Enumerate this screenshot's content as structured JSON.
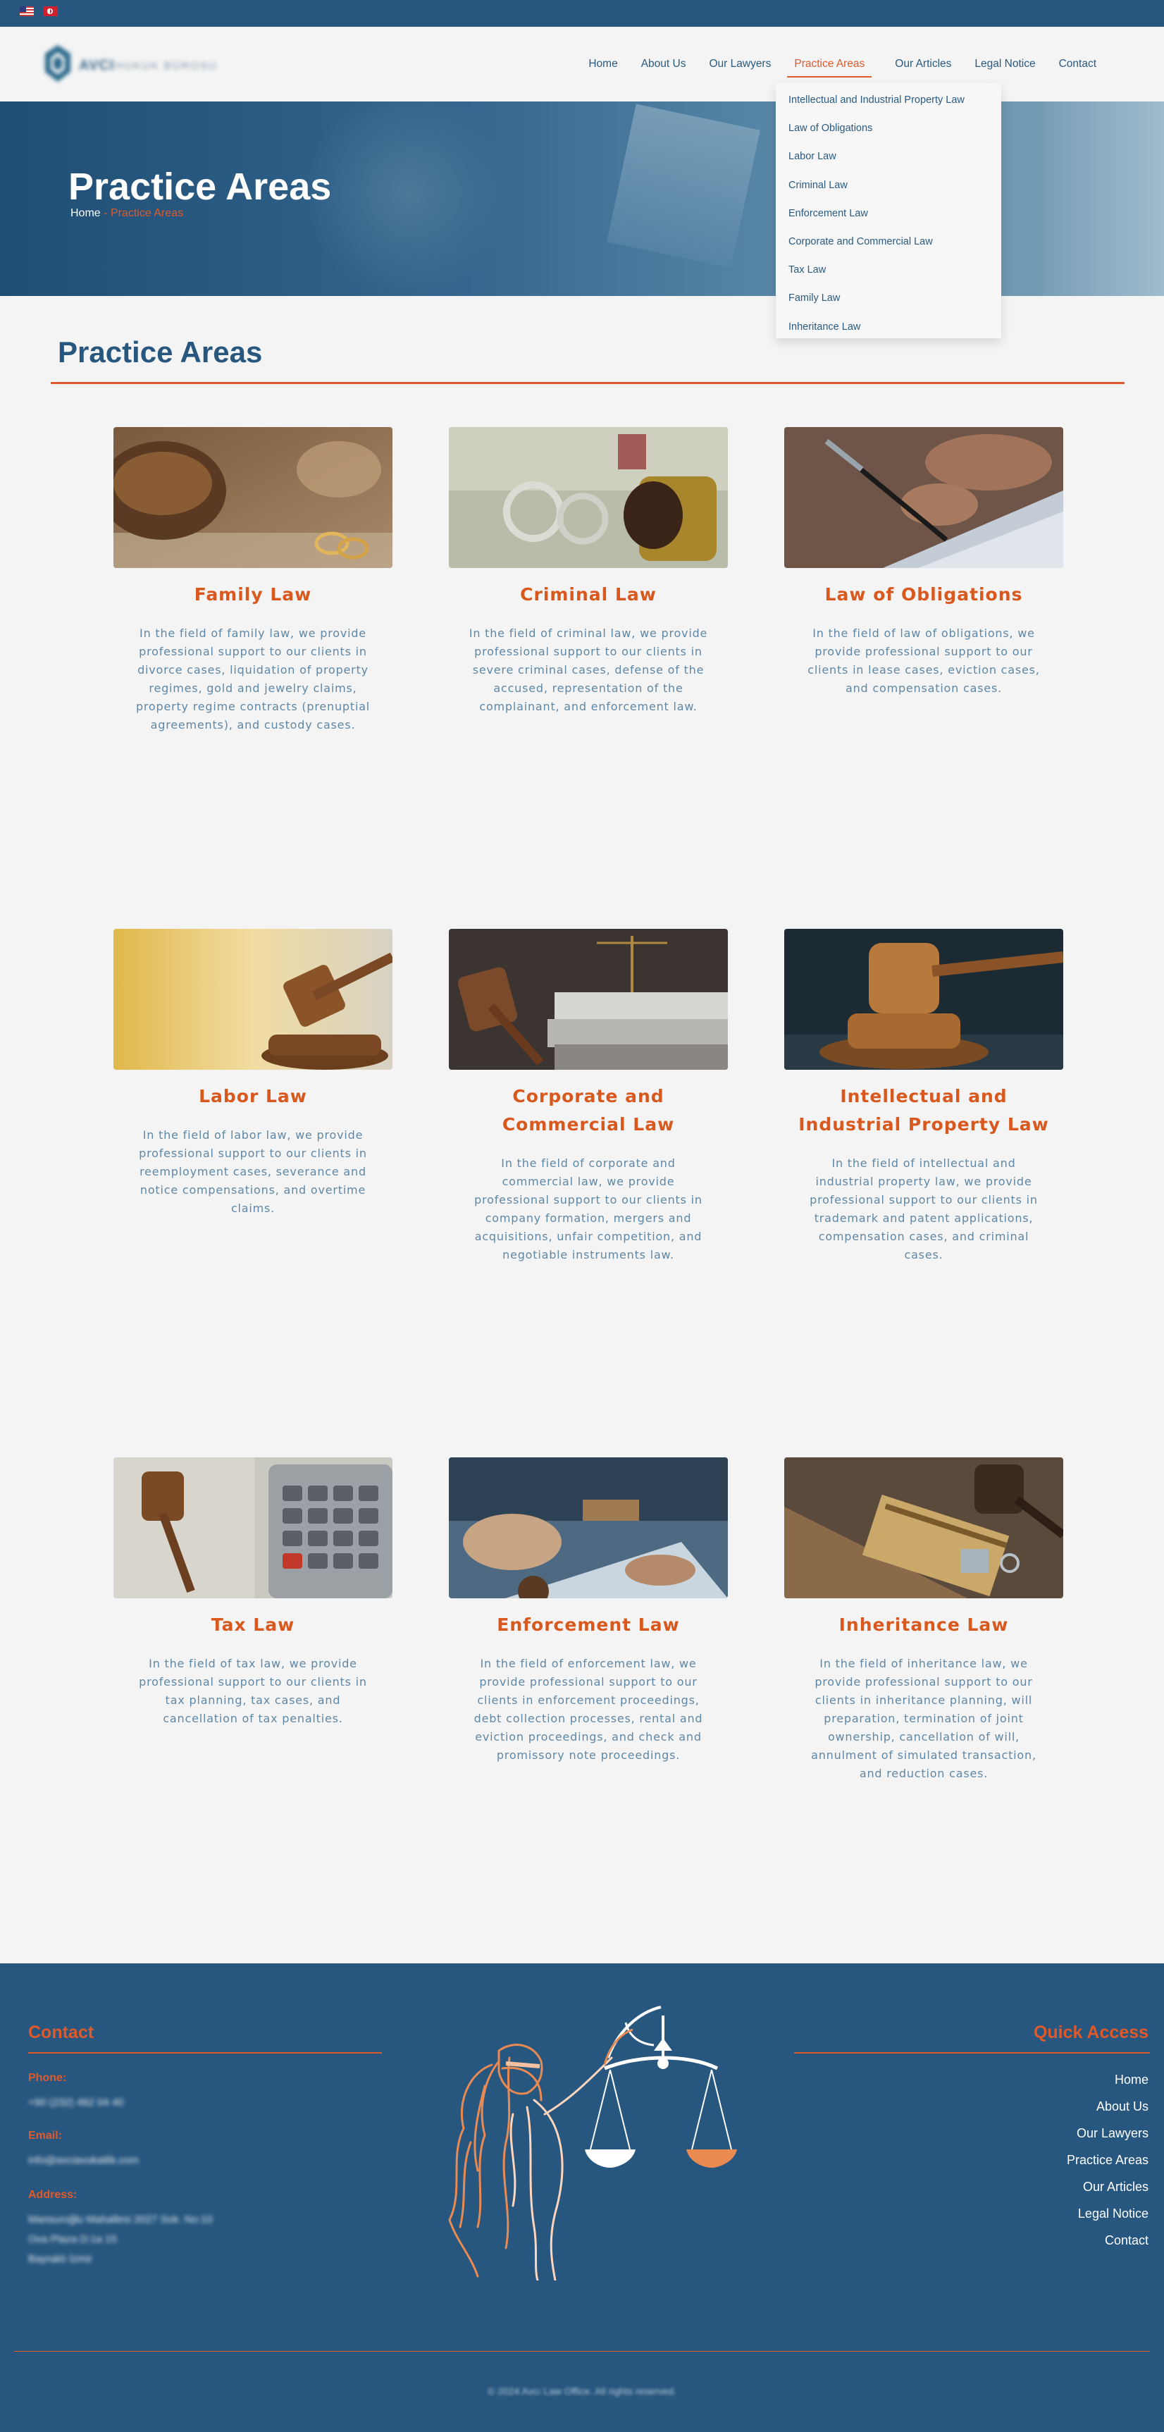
{
  "languages": [
    {
      "icon": "us-flag-icon"
    },
    {
      "icon": "tr-flag-icon"
    }
  ],
  "logo": {
    "text": "AVCI",
    "subtitle": "HUKUK BÜROSU"
  },
  "nav": {
    "items": [
      "Home",
      "About Us",
      "Our Lawyers",
      "Practice Areas",
      "Our Articles",
      "Legal Notice",
      "Contact"
    ],
    "active": "Practice Areas"
  },
  "dropdown": {
    "items": [
      "Intellectual and Industrial Property Law",
      "Law of Obligations",
      "Labor Law",
      "Criminal Law",
      "Enforcement Law",
      "Corporate and Commercial Law",
      "Tax Law",
      "Family Law",
      "Inheritance Law"
    ]
  },
  "hero": {
    "title": "Practice Areas",
    "breadcrumb_home": "Home",
    "breadcrumb_sep": "-",
    "breadcrumb_current": "Practice Areas"
  },
  "section": {
    "title": "Practice Areas"
  },
  "cards": [
    {
      "title": "Family Law",
      "text": "In the field of family law, we provide professional support to our clients in divorce cases, liquidation of property regimes, gold and jewelry claims, property regime contracts (prenuptial agreements), and custody cases."
    },
    {
      "title": "Criminal Law",
      "text": "In the field of criminal law, we provide professional support to our clients in severe criminal cases, defense of the accused, representation of the complainant, and enforcement law."
    },
    {
      "title": "Law of Obligations",
      "text": "In the field of law of obligations, we provide professional support to our clients in lease cases, eviction cases, and compensation cases."
    },
    {
      "title": "Labor Law",
      "text": "In the field of labor law, we provide professional support to our clients in reemployment cases, severance and notice compensations, and overtime claims."
    },
    {
      "title": "Corporate and Commercial Law",
      "text": "In the field of corporate and commercial law, we provide professional support to our clients in company formation, mergers and acquisitions, unfair competition, and negotiable instruments law."
    },
    {
      "title": "Intellectual and Industrial Property Law",
      "text": "In the field of intellectual and industrial property law, we provide professional support to our clients in trademark and patent applications, compensation cases, and criminal cases."
    },
    {
      "title": "Tax Law",
      "text": "In the field of tax law, we provide professional support to our clients in tax planning, tax cases, and cancellation of tax penalties."
    },
    {
      "title": "Enforcement Law",
      "text": "In the field of enforcement law, we provide professional support to our clients in enforcement proceedings, debt collection processes, rental and eviction proceedings, and check and promissory note proceedings."
    },
    {
      "title": "Inheritance Law",
      "text": "In the field of inheritance law, we provide professional support to our clients in inheritance planning, will preparation, termination of joint ownership, cancellation of will, annulment of simulated transaction, and reduction cases."
    }
  ],
  "footer": {
    "contact_title": "Contact",
    "phone_label": "Phone:",
    "phone": "+90 (232) 462 04 40",
    "email_label": "Email:",
    "email": "info@avciavukatlik.com",
    "address_label": "Address:",
    "address_lines": [
      "Mansuroğlu Mahallesi 2027 Sok. No:10",
      "Ova Plaza D:1a 15",
      "Bayraklı İzmir"
    ],
    "quick_title": "Quick Access",
    "quick_links": [
      "Home",
      "About Us",
      "Our Lawyers",
      "Practice Areas",
      "Our Articles",
      "Legal Notice",
      "Contact"
    ],
    "copyright": "© 2024 Avcı Law Office. All rights reserved."
  },
  "colors": {
    "primary": "#27567e",
    "accent": "#e0592a",
    "background": "#f4f4f4"
  }
}
